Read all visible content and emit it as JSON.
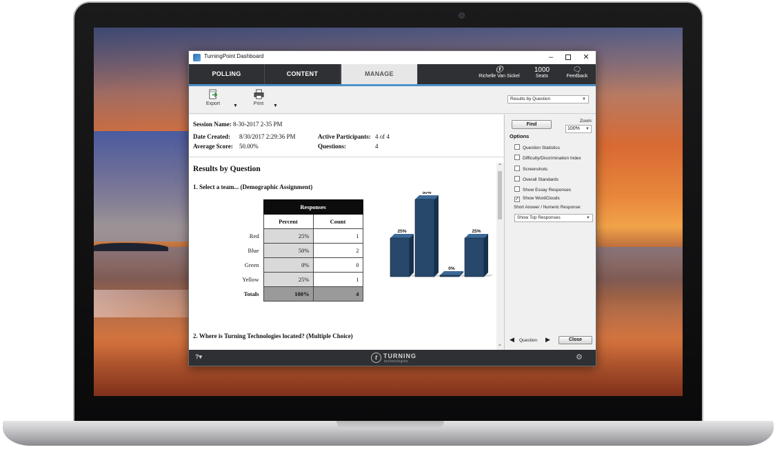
{
  "window": {
    "title": "TurningPoint Dashboard",
    "minimize": "–",
    "close": "✕"
  },
  "nav": {
    "tabs": [
      {
        "label": "POLLING"
      },
      {
        "label": "CONTENT"
      },
      {
        "label": "MANAGE",
        "active": true
      }
    ],
    "user_name": "Richelle Van Sickel",
    "seats_count": "1000",
    "seats_label": "Seats",
    "feedback_label": "Feedback"
  },
  "toolbar": {
    "export_label": "Export",
    "print_label": "Print",
    "view_select": "Results by Question"
  },
  "report": {
    "session_name_label": "Session Name:",
    "session_name": "8-30-2017 2-35 PM",
    "date_created_label": "Date Created:",
    "date_created": "8/30/2017 2:29:36 PM",
    "average_score_label": "Average Score:",
    "average_score": "50.00%",
    "active_participants_label": "Active Participants:",
    "active_participants": "4 of 4",
    "questions_label": "Questions:",
    "questions": "4",
    "section_title": "Results by Question",
    "q1_title": "1. Select a team... (Demographic Assignment)",
    "q2_title": "2. Where is Turning Technologies located? (Multiple Choice)",
    "table": {
      "header": "Responses",
      "col_percent": "Percent",
      "col_count": "Count",
      "rows": [
        {
          "label": "Red",
          "percent": "25%",
          "count": "1"
        },
        {
          "label": "Blue",
          "percent": "50%",
          "count": "2"
        },
        {
          "label": "Green",
          "percent": "0%",
          "count": "0"
        },
        {
          "label": "Yellow",
          "percent": "25%",
          "count": "1"
        }
      ],
      "totals_label": "Totals",
      "totals_percent": "100%",
      "totals_count": "4"
    }
  },
  "chart_data": {
    "type": "bar",
    "categories": [
      "Red",
      "Blue",
      "Green",
      "Yellow"
    ],
    "values": [
      25,
      50,
      0,
      25
    ],
    "labels": [
      "25%",
      "50%",
      "0%",
      "25%"
    ],
    "ylim": [
      0,
      50
    ],
    "color": "#27486b"
  },
  "options": {
    "find_label": "Find",
    "zoom_label": "Zoom:",
    "zoom_value": "100%",
    "heading": "Options",
    "items": [
      {
        "label": "Question Statistics",
        "checked": false
      },
      {
        "label": "Difficulty/Discrimination Index",
        "checked": false
      },
      {
        "label": "Screenshots",
        "checked": false
      },
      {
        "label": "Overall Standards",
        "checked": false
      },
      {
        "label": "Show Essay Responses",
        "checked": false
      },
      {
        "label": "Show WordClouds",
        "checked": true
      }
    ],
    "short_answer_label": "Short Answer / Numeric Response:",
    "short_answer_select": "Show Top Responses",
    "question_nav_label": "Question",
    "close_label": "Close"
  },
  "footer": {
    "brand_name": "TURNING",
    "brand_sub": "technologies"
  },
  "icons": {
    "help": "help-icon",
    "settings": "gear-icon",
    "user": "user-icon",
    "feedback": "feedback-icon",
    "export": "export-icon",
    "print": "printer-icon"
  }
}
